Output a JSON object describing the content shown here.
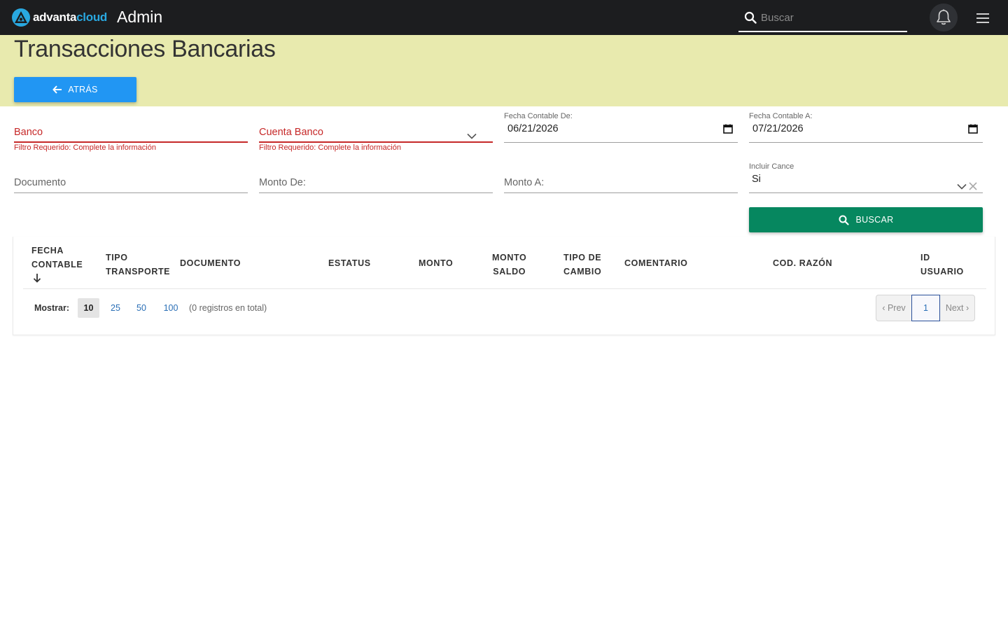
{
  "header": {
    "brand_part1": "advanta",
    "brand_part2": "cloud",
    "app_name": "Admin",
    "search_placeholder": "Buscar"
  },
  "page": {
    "title": "Transacciones Bancarias",
    "back_label": "ATRÁS"
  },
  "filters": {
    "banco_label": "Banco",
    "banco_error": "Filtro Requerido: Complete la información",
    "cuenta_label": "Cuenta Banco",
    "cuenta_error": "Filtro Requerido: Complete la información",
    "fecha_de_label": "Fecha Contable De:",
    "fecha_de_value": "06/21/2026",
    "fecha_a_label": "Fecha Contable A:",
    "fecha_a_value": "07/21/2026",
    "documento_label": "Documento",
    "monto_de_label": "Monto De:",
    "monto_a_label": "Monto A:",
    "cancel_label": "Incluir Cance",
    "cancel_value": "Si",
    "buscar_label": "BUSCAR"
  },
  "table": {
    "columns": [
      {
        "line1": "FECHA",
        "line2": "CONTABLE"
      },
      {
        "line1": "TIPO",
        "line2": "TRANSPORTE"
      },
      {
        "line1": "DOCUMENTO",
        "line2": ""
      },
      {
        "line1": "ESTATUS",
        "line2": ""
      },
      {
        "line1": "MONTO",
        "line2": ""
      },
      {
        "line1": "MONTO",
        "line2": "SALDO"
      },
      {
        "line1": "TIPO DE",
        "line2": "CAMBIO"
      },
      {
        "line1": "COMENTARIO",
        "line2": ""
      },
      {
        "line1": "COD. RAZÓN",
        "line2": ""
      },
      {
        "line1": "ID",
        "line2": "USUARIO"
      }
    ],
    "show_label": "Mostrar:",
    "page_sizes": [
      "10",
      "25",
      "50",
      "100"
    ],
    "total_text": "(0 registros en total)",
    "prev_label": "‹ Prev",
    "current_page": "1",
    "next_label": "Next ›"
  },
  "colors": {
    "topbar": "#1c1d1f",
    "band": "#e8eaae",
    "back_button": "#2196f3",
    "search_button": "#06875f",
    "error": "#c62828",
    "brand_accent": "#29a8e0"
  }
}
